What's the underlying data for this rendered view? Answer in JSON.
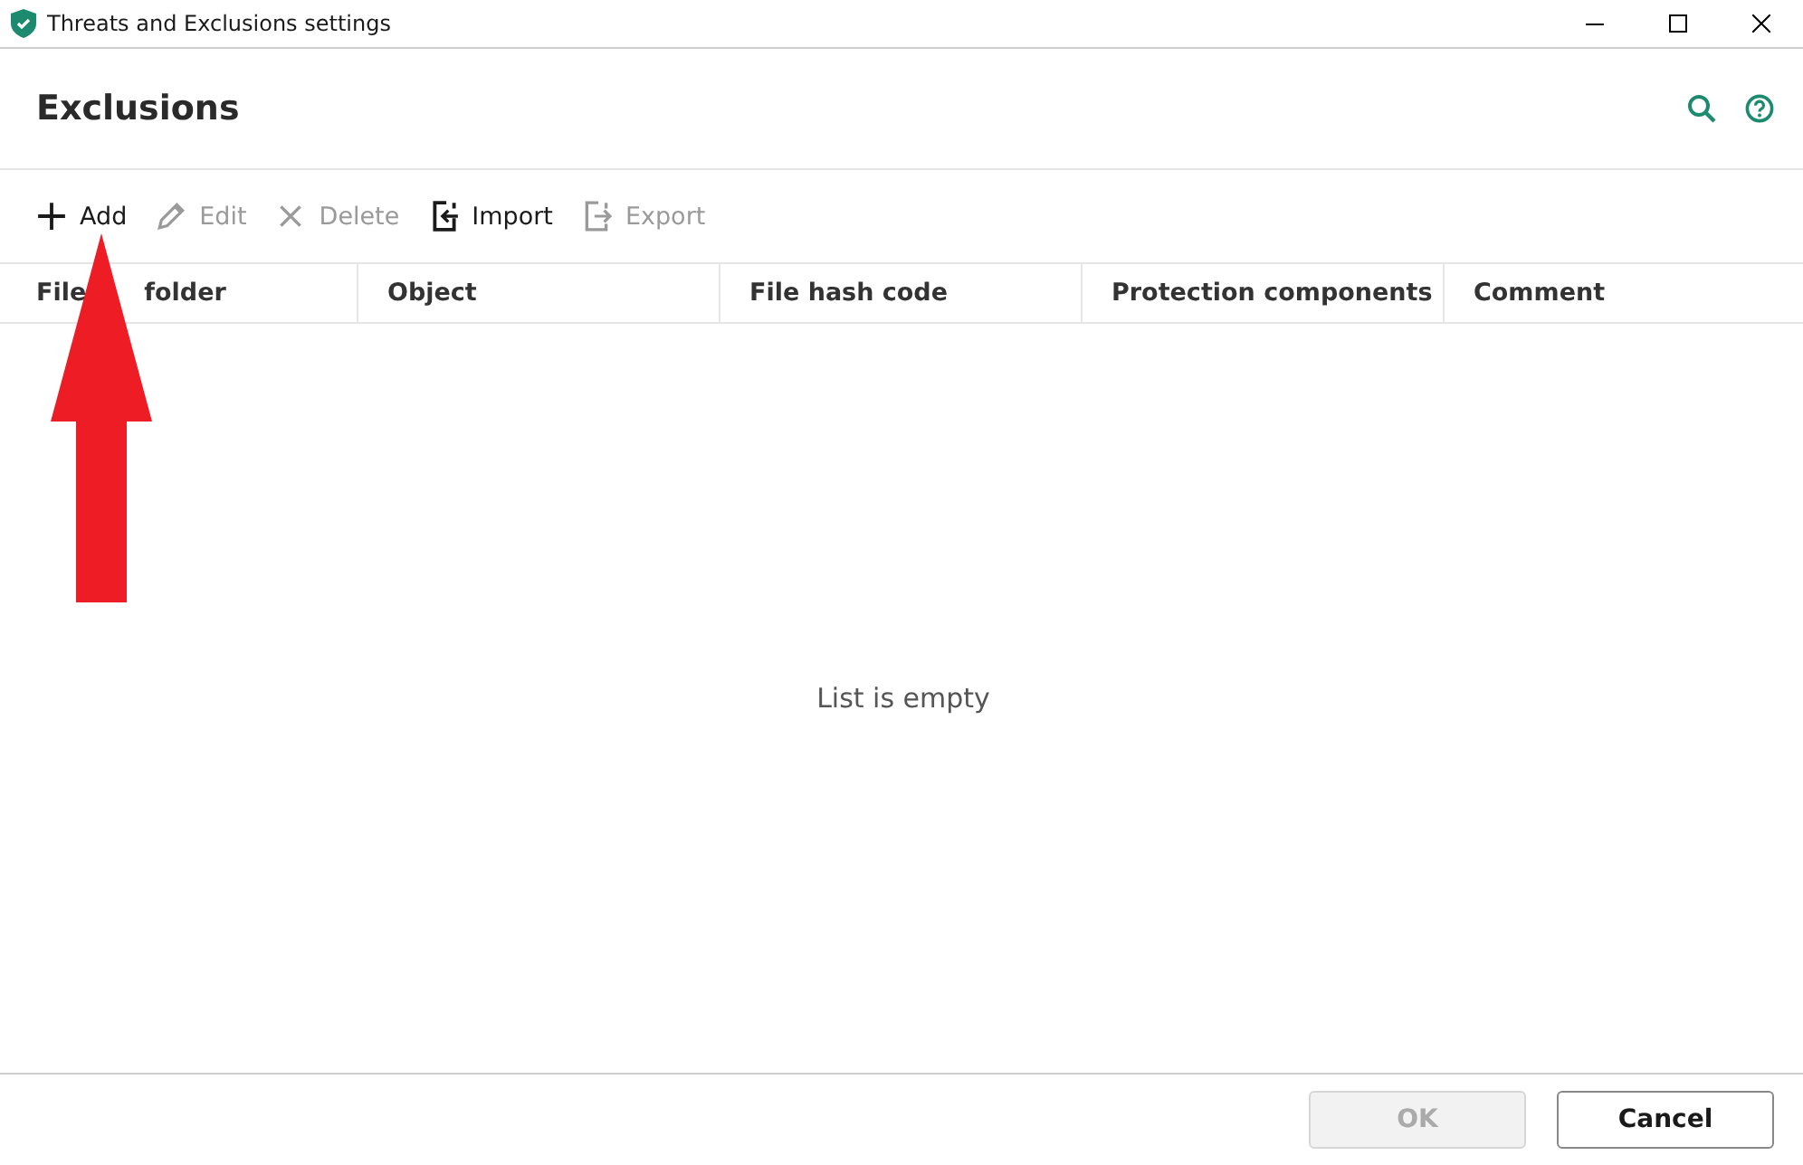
{
  "window": {
    "title": "Threats and Exclusions settings"
  },
  "header": {
    "title": "Exclusions"
  },
  "toolbar": [
    {
      "kind": "add",
      "label": "Add",
      "disabled": false
    },
    {
      "kind": "edit",
      "label": "Edit",
      "disabled": true
    },
    {
      "kind": "delete",
      "label": "Delete",
      "disabled": true
    },
    {
      "kind": "import",
      "label": "Import",
      "disabled": false
    },
    {
      "kind": "export",
      "label": "Export",
      "disabled": true
    }
  ],
  "table": {
    "columns": [
      [
        "File",
        "folder"
      ],
      "Object",
      "File hash code",
      "Protection components",
      "Comment"
    ],
    "empty_message": "List is empty"
  },
  "buttons": [
    {
      "label": "OK",
      "disabled": true
    },
    {
      "label": "Cancel",
      "disabled": false
    }
  ]
}
